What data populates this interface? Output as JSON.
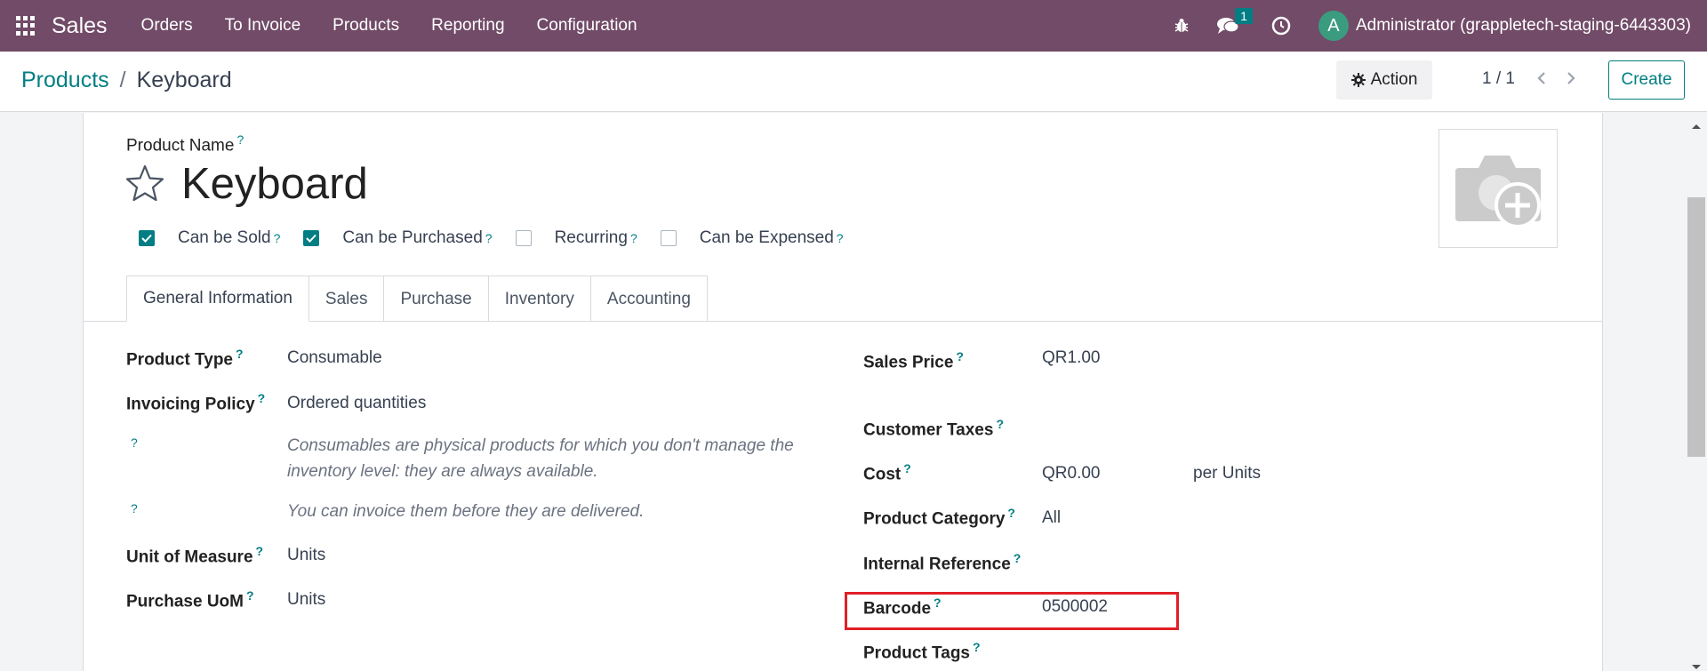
{
  "navbar": {
    "app_name": "Sales",
    "menu": [
      "Orders",
      "To Invoice",
      "Products",
      "Reporting",
      "Configuration"
    ],
    "message_count": "1",
    "avatar_letter": "A",
    "user": "Administrator (grappletech-staging-6443303)"
  },
  "breadcrumb": {
    "parent": "Products",
    "separator": "/",
    "current": "Keyboard"
  },
  "controls": {
    "action": "Action",
    "pager": "1 / 1",
    "create": "Create"
  },
  "product": {
    "name_label": "Product Name",
    "name": "Keyboard",
    "help_mark": "?"
  },
  "flags": [
    {
      "label": "Can be Sold",
      "checked": true
    },
    {
      "label": "Can be Purchased",
      "checked": true
    },
    {
      "label": "Recurring",
      "checked": false
    },
    {
      "label": "Can be Expensed",
      "checked": false
    }
  ],
  "tabs": [
    "General Information",
    "Sales",
    "Purchase",
    "Inventory",
    "Accounting"
  ],
  "left_fields": {
    "product_type_label": "Product Type",
    "product_type": "Consumable",
    "invoicing_policy_label": "Invoicing Policy",
    "invoicing_policy": "Ordered quantities",
    "help1": "Consumables are physical products for which you don't manage the inventory level: they are always available.",
    "help2": "You can invoice them before they are delivered.",
    "uom_label": "Unit of Measure",
    "uom": "Units",
    "purchase_uom_label": "Purchase UoM",
    "purchase_uom": "Units"
  },
  "right_fields": {
    "sales_price_label": "Sales Price",
    "sales_price": "QR1.00",
    "customer_taxes_label": "Customer Taxes",
    "cost_label": "Cost",
    "cost": "QR0.00",
    "cost_unit": "per Units",
    "category_label": "Product Category",
    "category": "All",
    "internal_ref_label": "Internal Reference",
    "barcode_label": "Barcode",
    "barcode": "0500002",
    "tags_label": "Product Tags"
  },
  "colors": {
    "navbar": "#714b67",
    "accent": "#017e84",
    "highlight": "#e11f26"
  }
}
